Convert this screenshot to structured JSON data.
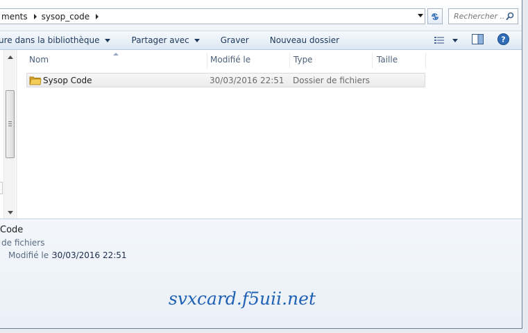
{
  "breadcrumb": [
    "ments",
    "sysop_code"
  ],
  "search": {
    "placeholder": "Rechercher ..."
  },
  "toolbar": {
    "library_label": "ure dans la bibliothèque",
    "share_label": "Partager avec",
    "burn_label": "Graver",
    "new_folder_label": "Nouveau dossier"
  },
  "columns": {
    "name": "Nom",
    "modified": "Modifié le",
    "type": "Type",
    "size": "Taille"
  },
  "files": [
    {
      "name": "Sysop Code",
      "modified": "30/03/2016 22:51",
      "type": "Dossier de fichiers",
      "size": ""
    }
  ],
  "details": {
    "title": "Code",
    "type": "de fichiers",
    "modified_label": "Modifié le :",
    "modified_value": "30/03/2016 22:51"
  },
  "watermark": "svxcard.f5uii.net",
  "icons": [
    "arrow-right-icon",
    "refresh-icon",
    "search-icon",
    "view-options-icon",
    "preview-pane-icon",
    "help-icon",
    "folder-icon"
  ],
  "colors": {
    "accent": "#1e60b4",
    "toolbar_text": "#1e395b",
    "header_text": "#4c607a"
  }
}
